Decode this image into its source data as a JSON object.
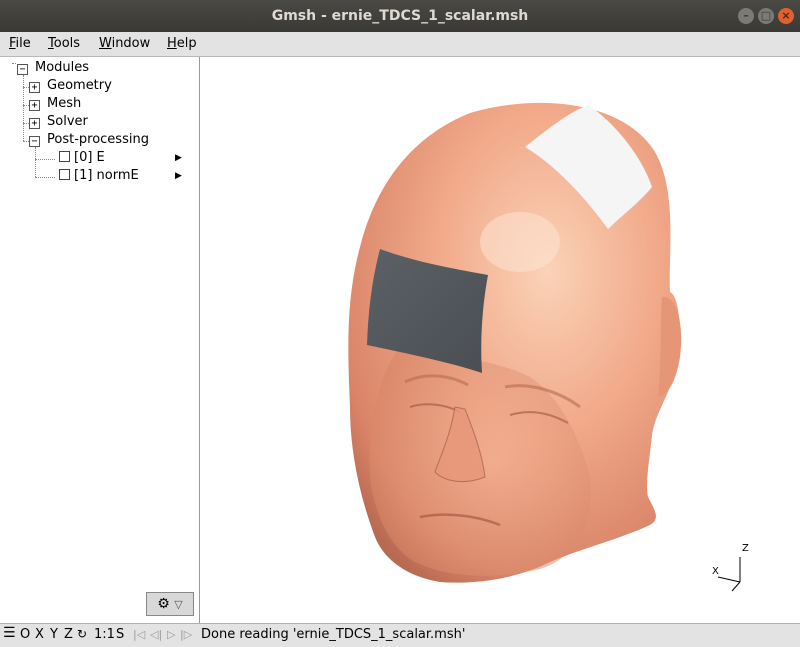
{
  "window": {
    "title": "Gmsh - ernie_TDCS_1_scalar.msh",
    "controls": [
      "minimize",
      "maximize",
      "close"
    ]
  },
  "menu": {
    "items": [
      {
        "label": "File"
      },
      {
        "label": "Tools"
      },
      {
        "label": "Window"
      },
      {
        "label": "Help"
      }
    ]
  },
  "tree": {
    "root": "Modules",
    "items": [
      {
        "label": "Geometry",
        "expander": "+"
      },
      {
        "label": "Mesh",
        "expander": "+"
      },
      {
        "label": "Solver",
        "expander": "+"
      },
      {
        "label": "Post-processing",
        "expander": "−"
      }
    ],
    "views": [
      {
        "label": "[0] E",
        "checked": false
      },
      {
        "label": "[1] normE",
        "checked": false
      }
    ]
  },
  "axes": {
    "z": "Z",
    "x": "X"
  },
  "statusbar": {
    "buttons": [
      "O",
      "X",
      "Y",
      "Z"
    ],
    "scale": "1:1",
    "s": "S",
    "message": "Done reading 'ernie_TDCS_1_scalar.msh'"
  },
  "colors": {
    "skin": "#f0a886",
    "electrode_dark": "#555a60",
    "electrode_light": "#f4f4f4",
    "titlebar": "#3d3c38"
  }
}
